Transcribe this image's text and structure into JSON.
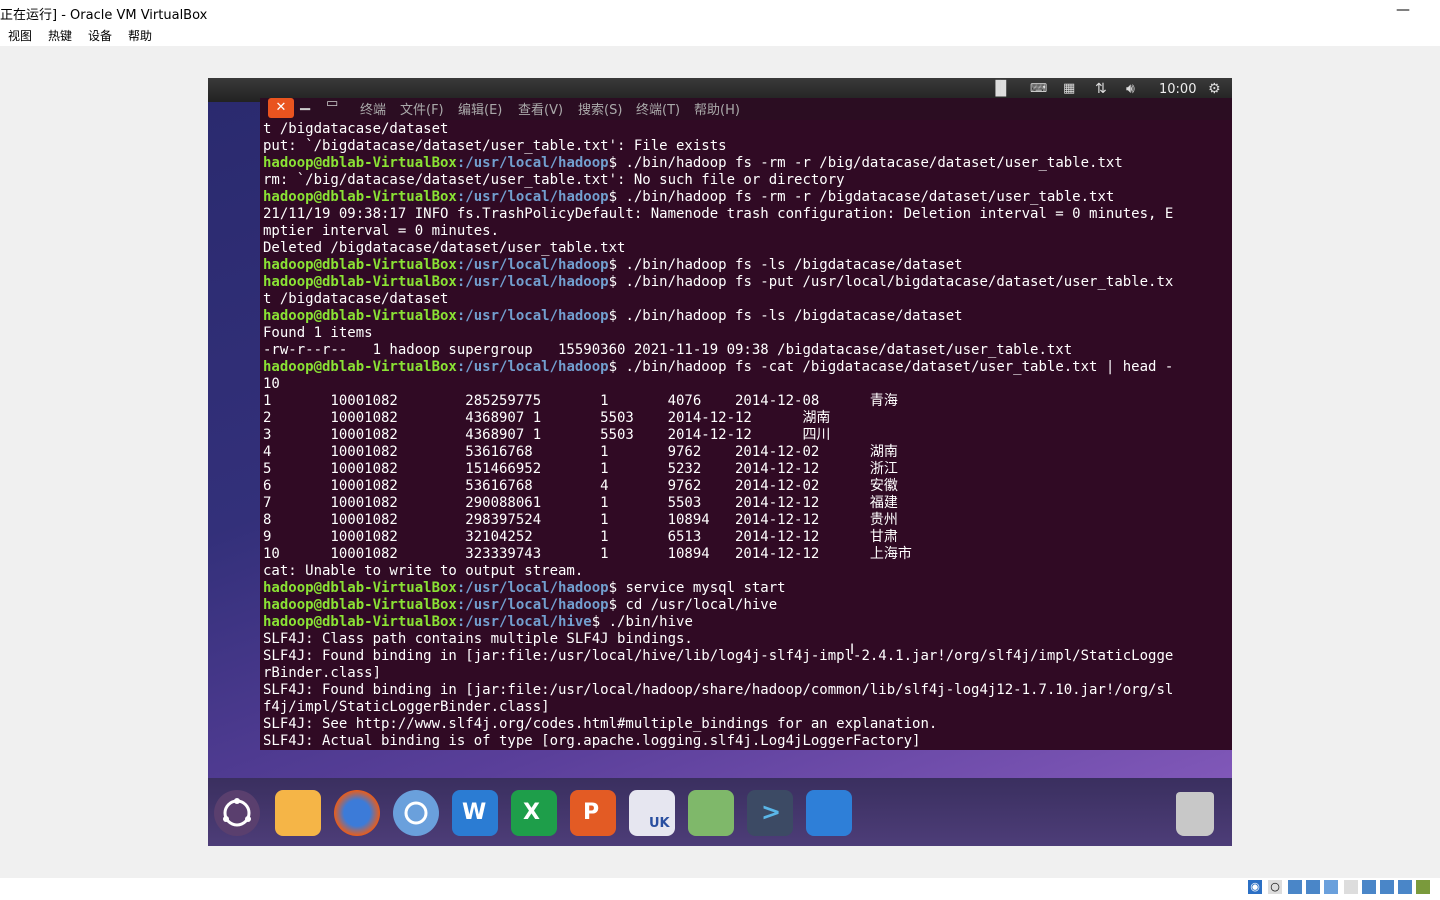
{
  "host": {
    "title": "正在运行] - Oracle VM VirtualBox",
    "menu": [
      "视图",
      "热键",
      "设备",
      "帮助"
    ]
  },
  "guest_topbar": {
    "clock": "10:00"
  },
  "terminal_menu": {
    "items": [
      "终端",
      "文件(F)",
      "编辑(E)",
      "查看(V)",
      "搜索(S)",
      "终端(T)",
      "帮助(H)"
    ]
  },
  "terminal": {
    "user": "hadoop@dblab-VirtualBox",
    "lines": [
      {
        "t": "t /bigdatacase/dataset"
      },
      {
        "t": "put: `/bigdatacase/dataset/user_table.txt': File exists"
      },
      {
        "path": ":/usr/local/hadoop",
        "cmd": "$ ./bin/hadoop fs -rm -r /big/datacase/dataset/user_table.txt"
      },
      {
        "t": "rm: `/big/datacase/dataset/user_table.txt': No such file or directory"
      },
      {
        "path": ":/usr/local/hadoop",
        "cmd": "$ ./bin/hadoop fs -rm -r /bigdatacase/dataset/user_table.txt"
      },
      {
        "t": "21/11/19 09:38:17 INFO fs.TrashPolicyDefault: Namenode trash configuration: Deletion interval = 0 minutes, E"
      },
      {
        "t": "mptier interval = 0 minutes."
      },
      {
        "t": "Deleted /bigdatacase/dataset/user_table.txt"
      },
      {
        "path": ":/usr/local/hadoop",
        "cmd": "$ ./bin/hadoop fs -ls /bigdatacase/dataset"
      },
      {
        "path": ":/usr/local/hadoop",
        "cmd": "$ ./bin/hadoop fs -put /usr/local/bigdatacase/dataset/user_table.tx"
      },
      {
        "t": "t /bigdatacase/dataset"
      },
      {
        "path": ":/usr/local/hadoop",
        "cmd": "$ ./bin/hadoop fs -ls /bigdatacase/dataset"
      },
      {
        "t": "Found 1 items"
      },
      {
        "t": "-rw-r--r--   1 hadoop supergroup   15590360 2021-11-19 09:38 /bigdatacase/dataset/user_table.txt"
      },
      {
        "path": ":/usr/local/hadoop",
        "cmd": "$ ./bin/hadoop fs -cat /bigdatacase/dataset/user_table.txt | head -"
      },
      {
        "t": "10"
      },
      {
        "t": "1       10001082        285259775       1       4076    2014-12-08      青海"
      },
      {
        "t": "2       10001082        4368907 1       5503    2014-12-12      湖南"
      },
      {
        "t": "3       10001082        4368907 1       5503    2014-12-12      四川"
      },
      {
        "t": "4       10001082        53616768        1       9762    2014-12-02      湖南"
      },
      {
        "t": "5       10001082        151466952       1       5232    2014-12-12      浙江"
      },
      {
        "t": "6       10001082        53616768        4       9762    2014-12-02      安徽"
      },
      {
        "t": "7       10001082        290088061       1       5503    2014-12-12      福建"
      },
      {
        "t": "8       10001082        298397524       1       10894   2014-12-12      贵州"
      },
      {
        "t": "9       10001082        32104252        1       6513    2014-12-12      甘肃"
      },
      {
        "t": "10      10001082        323339743       1       10894   2014-12-12      上海市"
      },
      {
        "t": "cat: Unable to write to output stream."
      },
      {
        "path": ":/usr/local/hadoop",
        "cmd": "$ service mysql start"
      },
      {
        "path": ":/usr/local/hadoop",
        "cmd": "$ cd /usr/local/hive"
      },
      {
        "path": ":/usr/local/hive",
        "cmd": "$ ./bin/hive"
      },
      {
        "t": "SLF4J: Class path contains multiple SLF4J bindings."
      },
      {
        "t": "SLF4J: Found binding in [jar:file:/usr/local/hive/lib/log4j-slf4j-impl-2.4.1.jar!/org/slf4j/impl/StaticLogge"
      },
      {
        "t": "rBinder.class]"
      },
      {
        "t": "SLF4J: Found binding in [jar:file:/usr/local/hadoop/share/hadoop/common/lib/slf4j-log4j12-1.7.10.jar!/org/sl"
      },
      {
        "t": "f4j/impl/StaticLoggerBinder.class]"
      },
      {
        "t": "SLF4J: See http://www.slf4j.org/codes.html#multiple_bindings for an explanation."
      },
      {
        "t": "SLF4J: Actual binding is of type [org.apache.logging.slf4j.Log4jLoggerFactory]"
      }
    ]
  },
  "dock": {
    "icons": [
      "ubuntu-icon",
      "files-icon",
      "firefox-icon",
      "chromium-icon",
      "word-icon",
      "excel-icon",
      "powerpoint-icon",
      "uk-app-icon",
      "software-icon",
      "terminal-icon",
      "window-icon",
      "trash-icon"
    ],
    "uk_label": "UK"
  },
  "colors": {
    "terminal_bg": "#300a24",
    "prompt_user": "#8ae234",
    "prompt_path": "#729fcf",
    "close_button": "#e9541f"
  }
}
